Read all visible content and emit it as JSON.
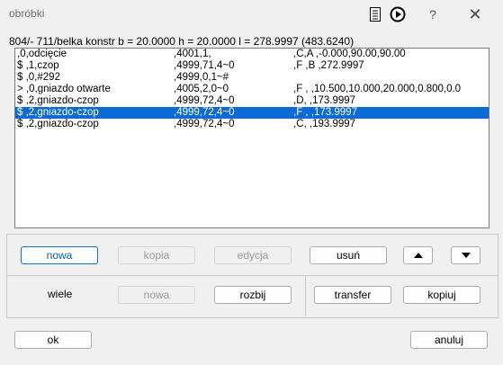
{
  "window": {
    "title": "obróbki",
    "help": "?",
    "close": "✕"
  },
  "info": "804/- 711/belka konstr b = 20.0000 h = 20.0000 l = 278.9997 (483.6240)",
  "rows": [
    {
      "c1": "  ,0,odcięcie",
      "c2": ",4001,1,",
      "c3": ",C,A ,-0.000,90.00,90.00"
    },
    {
      "c1": "$ ,1,czop",
      "c2": ",4999,71,4~0",
      "c3": ",F ,B ,272.9997"
    },
    {
      "c1": "$ ,0,#292",
      "c2": ",4999,0,1~#",
      "c3": ""
    },
    {
      "c1": "> ,0,gniazdo otwarte",
      "c2": ",4005,2,0~0",
      "c3": ",F ,   ,10.500,10.000,20.000,0.800,0.0"
    },
    {
      "c1": "$ ,2,gniazdo-czop",
      "c2": ",4999,72,4~0",
      "c3": ",D,   ,173.9997"
    },
    {
      "c1": "$ ,2,gniazdo-czop",
      "c2": ",4999,72,4~0",
      "c3": ",F ,   ,173.9997"
    },
    {
      "c1": "$ ,2,gniazdo-czop",
      "c2": ",4999,72,4~0",
      "c3": ",C,   ,193.9997"
    }
  ],
  "selected_row": 5,
  "buttons": {
    "nowa": "nowa",
    "kopia": "kopia",
    "edycja": "edycja",
    "usun": "usuń",
    "wiele": "wiele",
    "nowa2": "nowa",
    "rozbij": "rozbij",
    "transfer": "transfer",
    "kopiuj": "kopiuj",
    "ok": "ok",
    "anuluj": "anuluj"
  },
  "icons": [
    "document-icon",
    "play-circle-icon",
    "arrow-up-icon",
    "arrow-down-icon"
  ],
  "colors": {
    "selection": "#0b6ad3",
    "default_button_text": "#0b5fa8",
    "default_button_border": "#0078d4"
  }
}
